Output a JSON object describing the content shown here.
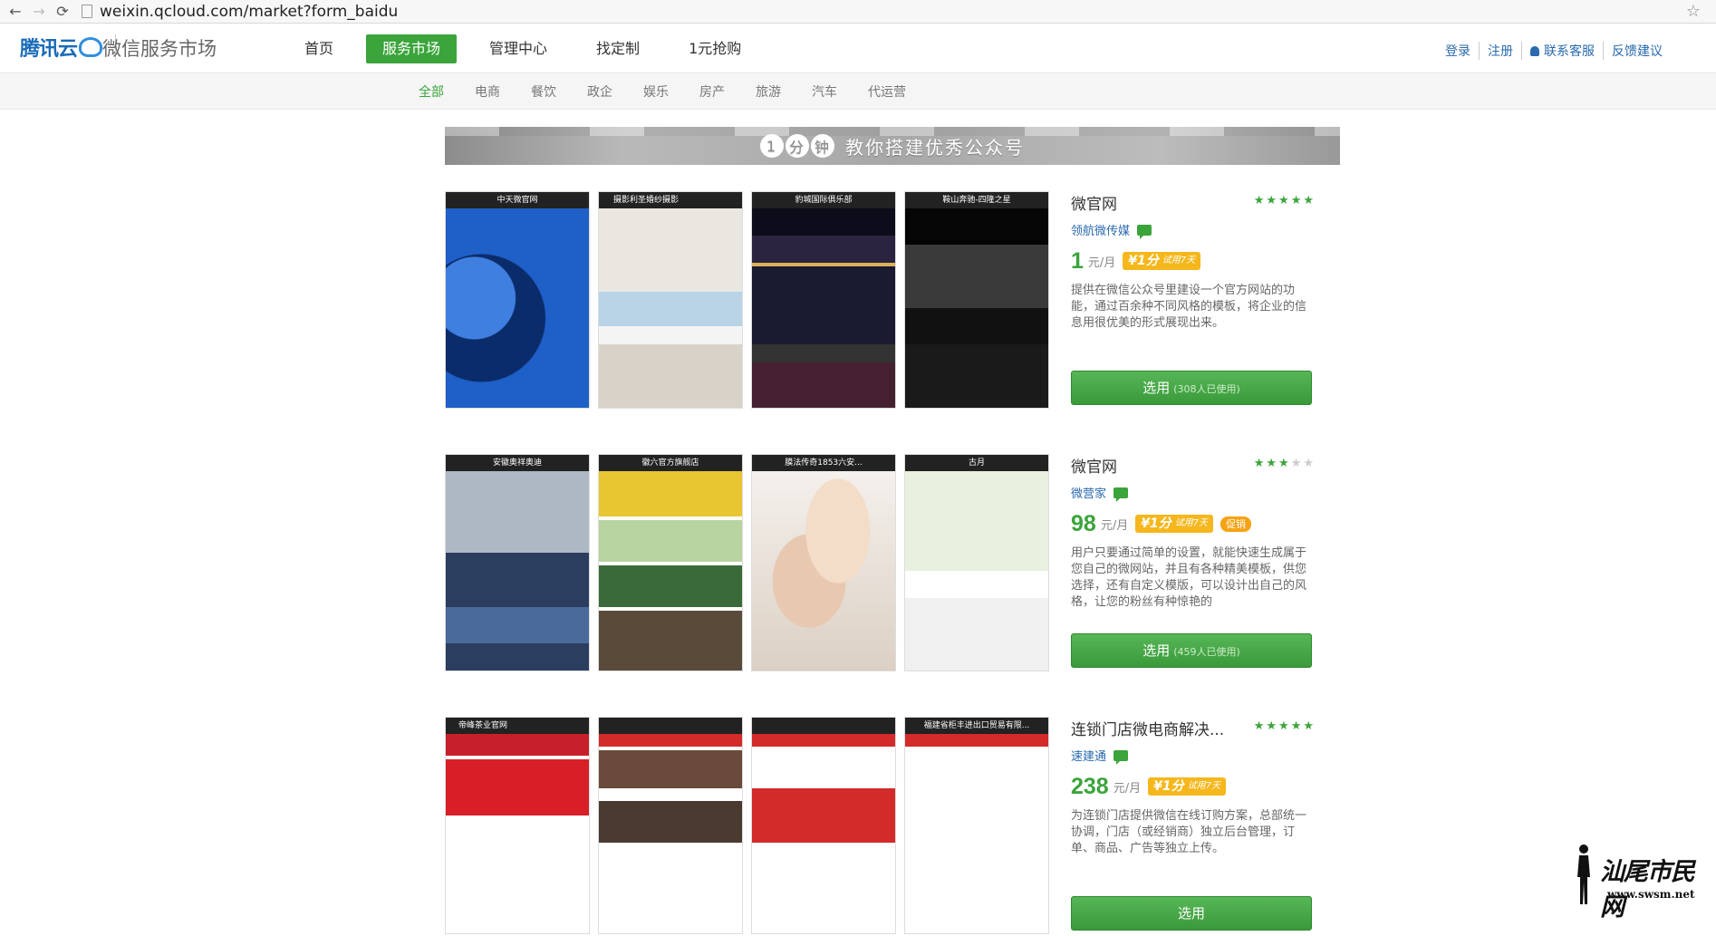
{
  "browser": {
    "url": "weixin.qcloud.com/market?form_baidu"
  },
  "header": {
    "logo": "腾讯云",
    "site_name": "微信服务市场",
    "nav": [
      {
        "label": "首页",
        "active": false
      },
      {
        "label": "服务市场",
        "active": true
      },
      {
        "label": "管理中心",
        "active": false
      },
      {
        "label": "找定制",
        "active": false
      },
      {
        "label": "1元抢购",
        "active": false
      }
    ],
    "links": {
      "login": "登录",
      "register": "注册",
      "support": "联系客服",
      "feedback": "反馈建议"
    }
  },
  "categories": [
    "全部",
    "电商",
    "餐饮",
    "政企",
    "娱乐",
    "房产",
    "旅游",
    "汽车",
    "代运营"
  ],
  "banner": {
    "chars": [
      "1",
      "分",
      "钟"
    ],
    "text": "教你搭建优秀公众号"
  },
  "products": [
    {
      "title": "微官网",
      "rating": 4.5,
      "vendor": "领航微传媒",
      "price": "1",
      "unit": "元/月",
      "trial_price": "¥1分",
      "trial_label": "试用7天",
      "desc": "提供在微信公众号里建设一个官方网站的功能，通过百余种不同风格的模板，将企业的信息用很优美的形式展现出来。",
      "button": "选用",
      "used": "(308人已使用)",
      "thumbs": [
        "中天微官网",
        "摄影利圣婚纱摄影",
        "豹城国际俱乐部",
        "鞍山奔驰-四隆之星"
      ]
    },
    {
      "title": "微官网",
      "rating": 3,
      "vendor": "微营家",
      "price": "98",
      "unit": "元/月",
      "trial_price": "¥1分",
      "trial_label": "试用7天",
      "promo": "促销",
      "desc": "用户只要通过简单的设置，就能快速生成属于您自己的微网站，并且有各种精美模板，供您选择，还有自定义模版，可以设计出自己的风格，让您的粉丝有种惊艳的",
      "button": "选用",
      "used": "(459人已使用)",
      "thumbs": [
        "安徽奥祥奥迪",
        "徽六官方旗舰店",
        "膜法传奇1853六安...",
        "古月"
      ]
    },
    {
      "title": "连锁门店微电商解决...",
      "rating": 5,
      "vendor": "速建通",
      "price": "238",
      "unit": "元/月",
      "trial_price": "¥1分",
      "trial_label": "试用7天",
      "desc": "为连锁门店提供微信在线订购方案，总部统一协调，门店（或经销商）独立后台管理，订单、商品、广告等独立上传。",
      "button": "选用",
      "used": "",
      "thumbs": [
        "帝峰茶业官网",
        "",
        "",
        "福建省柜丰进出口贸易有限..."
      ]
    }
  ],
  "watermark": {
    "text": "汕尾市民网",
    "url": "www.swsm.net"
  }
}
